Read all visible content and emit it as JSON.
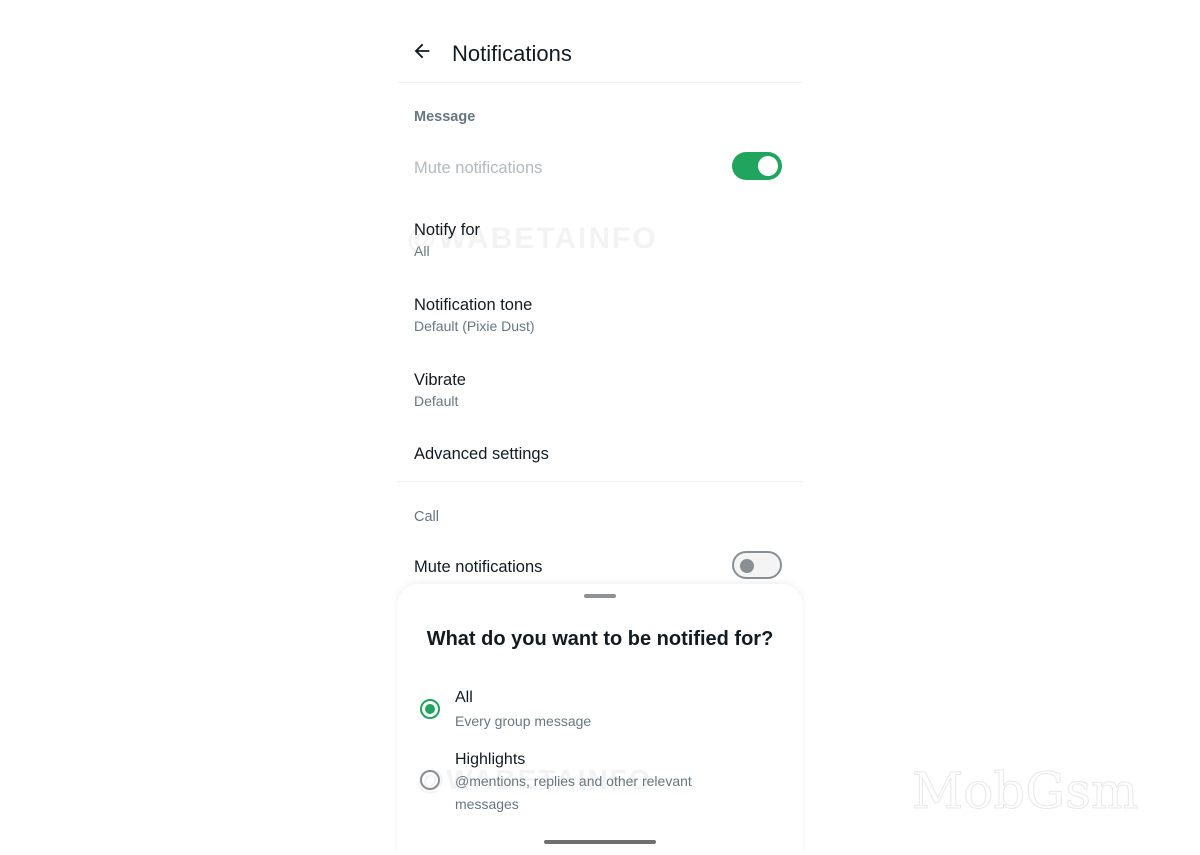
{
  "appbar": {
    "back_icon": "arrow-left-icon",
    "title": "Notifications"
  },
  "message_section": {
    "header": "Message",
    "mute": {
      "label": "Mute notifications",
      "enabled": true,
      "disabled_label": true
    },
    "notify_for": {
      "label": "Notify for",
      "value": "All"
    },
    "tone": {
      "label": "Notification tone",
      "value": "Default (Pixie Dust)"
    },
    "vibrate": {
      "label": "Vibrate",
      "value": "Default"
    },
    "advanced": {
      "label": "Advanced settings"
    }
  },
  "call_section": {
    "header": "Call",
    "mute": {
      "label": "Mute notifications",
      "enabled": false
    }
  },
  "sheet": {
    "title": "What do you want to be notified for?",
    "options": [
      {
        "label": "All",
        "description": "Every group message",
        "selected": true
      },
      {
        "label": "Highlights",
        "description": "@mentions, replies and other relevant messages",
        "selected": false
      }
    ]
  },
  "colors": {
    "accent": "#21a45d",
    "text_primary": "#111b21",
    "text_secondary": "#667781"
  },
  "watermarks": {
    "wabetainfo": "@WABETAINFO",
    "mobgsm": "MobGsm"
  }
}
